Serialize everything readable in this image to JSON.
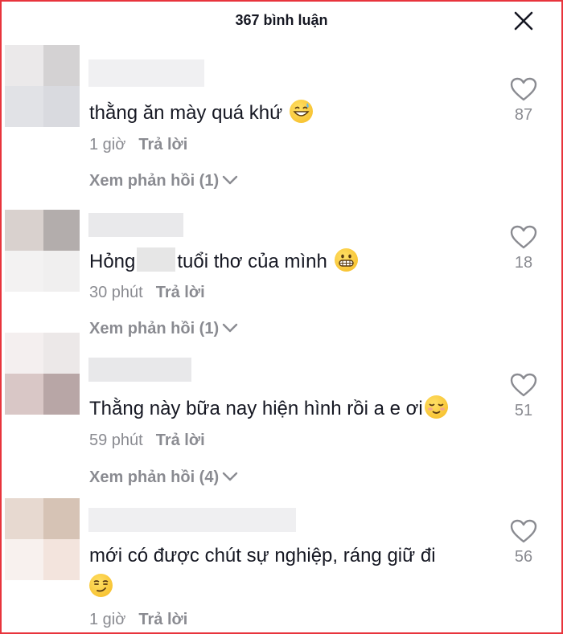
{
  "header": {
    "title": "367 bình luận",
    "close_icon": "close-icon"
  },
  "colors": {
    "frame_border": "#e8343c",
    "text_primary": "#161823",
    "text_secondary": "#8a8b91"
  },
  "comments": [
    {
      "text_before": "thằng ăn mày quá khứ",
      "text_after": "",
      "emoji": "grinning-sweat-emoji",
      "time": "1 giờ",
      "reply_label": "Trả lời",
      "view_replies": "Xem phản hồi (1)",
      "likes": "87"
    },
    {
      "text_before": "Hỏng",
      "text_after": "tuổi thơ của mình",
      "emoji": "grimacing-emoji",
      "time": "30 phút",
      "reply_label": "Trả lời",
      "view_replies": "Xem phản hồi (1)",
      "likes": "18"
    },
    {
      "text_before": "Thằng này bữa nay hiện hình rồi a e ơi",
      "text_after": "",
      "emoji": "relieved-emoji",
      "time": "59 phút",
      "reply_label": "Trả lời",
      "view_replies": "Xem phản hồi (4)",
      "likes": "51"
    },
    {
      "text_before": "mới có được chút sự nghiệp, ráng giữ đi",
      "text_after": "",
      "emoji": "smirking-emoji",
      "time": "1 giờ",
      "reply_label": "Trả lời",
      "view_replies": "",
      "likes": "56"
    }
  ]
}
